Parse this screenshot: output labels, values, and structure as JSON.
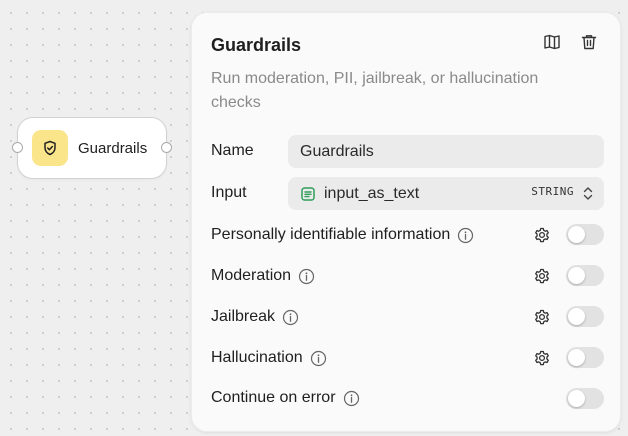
{
  "node": {
    "label": "Guardrails",
    "icon": "shield-check-icon",
    "icon_bg": "#fbe58b"
  },
  "panel": {
    "title": "Guardrails",
    "description": "Run moderation, PII, jailbreak, or hallucination checks",
    "header_icons": [
      "book-icon",
      "trash-icon"
    ],
    "name_label": "Name",
    "name_value": "Guardrails",
    "input_label": "Input",
    "input_value": "input_as_text",
    "input_type": "STRING",
    "input_icon": "text-variable-icon",
    "checks": [
      {
        "label": "Personally identifiable information",
        "enabled": false,
        "has_settings": true
      },
      {
        "label": "Moderation",
        "enabled": false,
        "has_settings": true
      },
      {
        "label": "Jailbreak",
        "enabled": false,
        "has_settings": true
      },
      {
        "label": "Hallucination",
        "enabled": false,
        "has_settings": true
      },
      {
        "label": "Continue on error",
        "enabled": false,
        "has_settings": false
      }
    ]
  },
  "colors": {
    "accent_green": "#2f9e5b",
    "toggle_off": "#e2e2e2"
  }
}
